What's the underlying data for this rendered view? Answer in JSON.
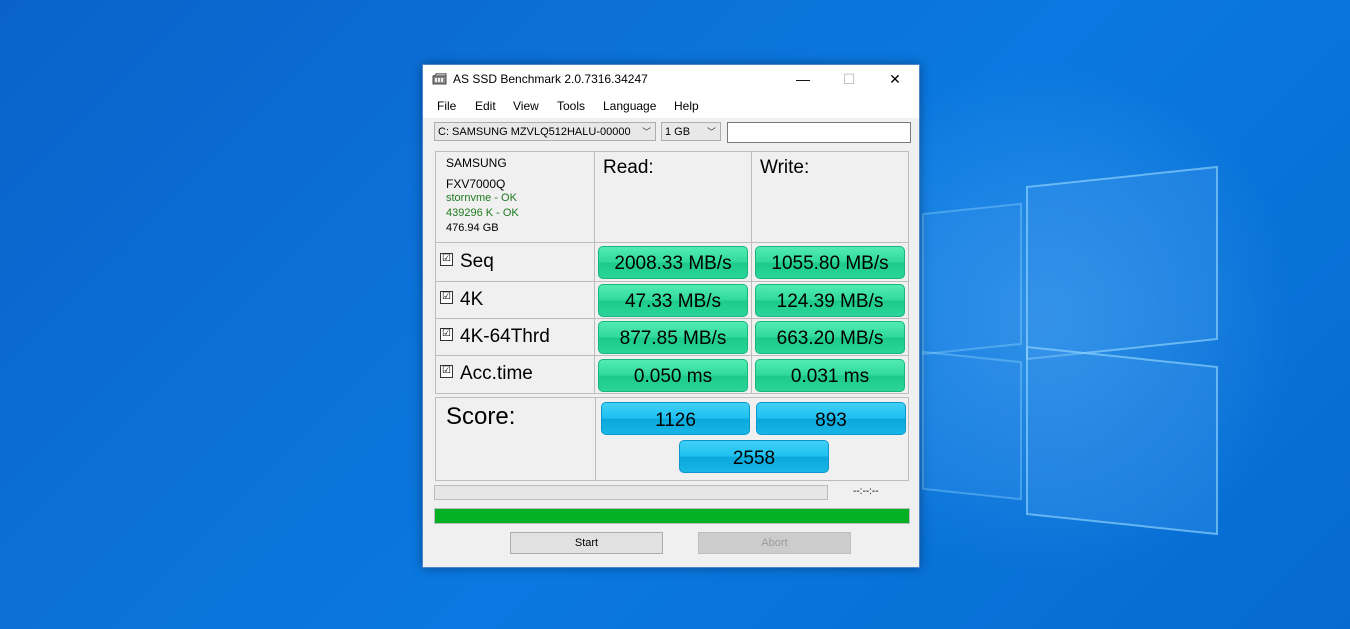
{
  "window": {
    "title": "AS SSD Benchmark 2.0.7316.34247",
    "minimize_glyph": "—",
    "maximize_glyph": "☐",
    "close_glyph": "✕"
  },
  "menu": [
    "File",
    "Edit",
    "View",
    "Tools",
    "Language",
    "Help"
  ],
  "toolbar": {
    "drive_selected": "C: SAMSUNG MZVLQ512HALU-00000",
    "size_selected": "1 GB",
    "text_value": ""
  },
  "drive_info": {
    "vendor": "SAMSUNG",
    "firmware": "FXV7000Q",
    "driver": "stornvme - OK",
    "alignment": "439296 K - OK",
    "capacity": "476.94 GB"
  },
  "headers": {
    "read": "Read:",
    "write": "Write:"
  },
  "rows": [
    {
      "label": "Seq",
      "checked": "☑",
      "read": "2008.33 MB/s",
      "write": "1055.80 MB/s"
    },
    {
      "label": "4K",
      "checked": "☑",
      "read": "47.33 MB/s",
      "write": "124.39 MB/s"
    },
    {
      "label": "4K-64Thrd",
      "checked": "☑",
      "read": "877.85 MB/s",
      "write": "663.20 MB/s"
    },
    {
      "label": "Acc.time",
      "checked": "☑",
      "read": "0.050 ms",
      "write": "0.031 ms"
    }
  ],
  "score": {
    "label": "Score:",
    "read": "1126",
    "write": "893",
    "total": "2558"
  },
  "progress": {
    "time_text": "--:--:--",
    "bottom_fraction": 1.0,
    "bottom_color": "#06b025"
  },
  "buttons": {
    "start": "Start",
    "abort": "Abort"
  },
  "colors": {
    "result_green": "#2fd89c",
    "score_blue": "#1ec0f0",
    "ok_text": "#1e7a1e"
  }
}
